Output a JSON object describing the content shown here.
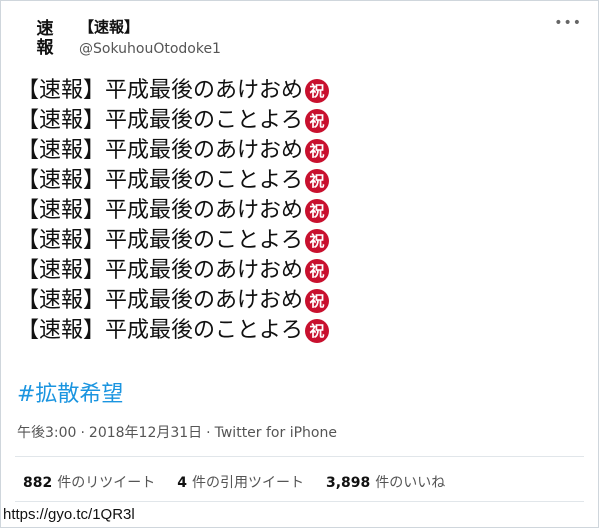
{
  "header": {
    "avatar_chars": [
      "速",
      "報"
    ],
    "display_name": "【速報】",
    "handle": "@SokuhouOtodoke1",
    "more_icon": "more-icon"
  },
  "tweet": {
    "lines": [
      "【速報】平成最後のあけおめ",
      "【速報】平成最後のことよろ",
      "【速報】平成最後のあけおめ",
      "【速報】平成最後のことよろ",
      "【速報】平成最後のあけおめ",
      "【速報】平成最後のことよろ",
      "【速報】平成最後のあけおめ",
      "【速報】平成最後のあけおめ",
      "【速報】平成最後のことよろ"
    ],
    "emoji_char": "祝",
    "emoji_color": "#c8102e",
    "hashtag": "#拡散希望",
    "hashtag_color": "#1b95e0"
  },
  "meta": {
    "time": "午後3:00",
    "date": "2018年12月31日",
    "separator": "·",
    "client": "Twitter for iPhone"
  },
  "stats": {
    "retweets_count": "882",
    "retweets_label": "件のリツイート",
    "quotes_count": "4",
    "quotes_label": "件の引用ツイート",
    "likes_count": "3,898",
    "likes_label": "件のいいね"
  },
  "source_url": "https://gyo.tc/1QR3l"
}
